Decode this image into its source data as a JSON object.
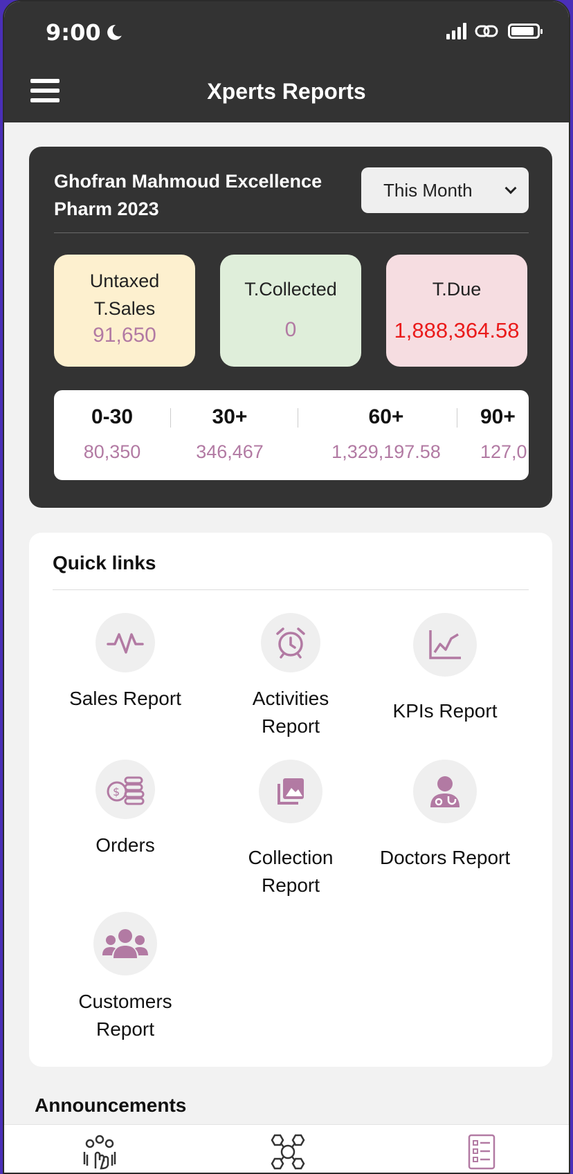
{
  "status_bar": {
    "time": "9:00"
  },
  "header": {
    "title": "Xperts Reports"
  },
  "summary": {
    "owner": "Ghofran Mahmoud Excellence Pharm 2023",
    "period": "This Month",
    "stats": {
      "sales_label": "Untaxed T.Sales",
      "sales_value": "91,650",
      "collected_label": "T.Collected",
      "collected_value": "0",
      "due_label": "T.Due",
      "due_value": "1,888,364.58"
    },
    "aging": [
      {
        "label": "0-30",
        "value": "80,350"
      },
      {
        "label": "30+",
        "value": "346,467"
      },
      {
        "label": "60+",
        "value": "1,329,197.58"
      },
      {
        "label": "90+",
        "value": "127,0"
      }
    ]
  },
  "quick_links": {
    "title": "Quick links",
    "items": [
      {
        "label": "Sales Report",
        "icon": "pulse-icon"
      },
      {
        "label": "Activities Report",
        "icon": "alarm-clock-icon"
      },
      {
        "label": "KPIs Report",
        "icon": "line-chart-icon"
      },
      {
        "label": "Orders",
        "icon": "coins-icon"
      },
      {
        "label": "Collection Report",
        "icon": "photo-gallery-icon"
      },
      {
        "label": "Doctors Report",
        "icon": "doctor-icon"
      },
      {
        "label": "Customers Report",
        "icon": "users-icon"
      }
    ]
  },
  "announcements": {
    "title": "Announcements"
  },
  "colors": {
    "accent": "#b27aa3",
    "header": "#333333",
    "due": "#ea1b1b"
  }
}
